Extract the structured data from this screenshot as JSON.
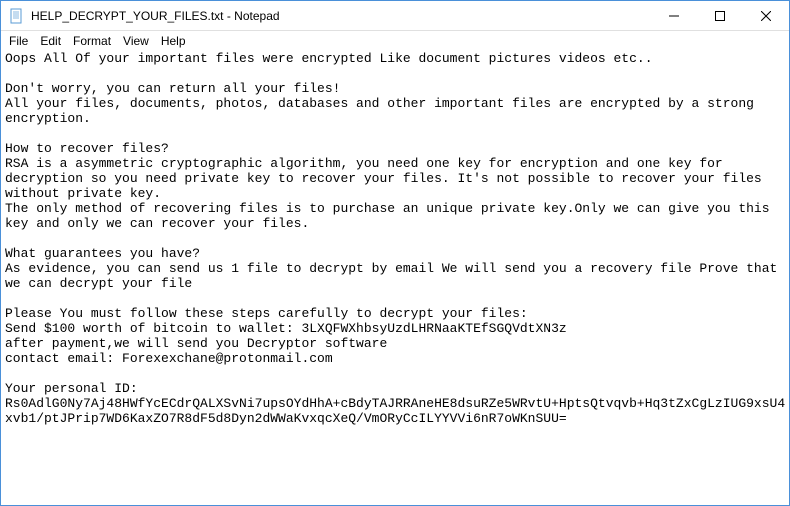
{
  "titlebar": {
    "title": "HELP_DECRYPT_YOUR_FILES.txt - Notepad"
  },
  "menubar": {
    "items": [
      {
        "label": "File"
      },
      {
        "label": "Edit"
      },
      {
        "label": "Format"
      },
      {
        "label": "View"
      },
      {
        "label": "Help"
      }
    ]
  },
  "content": {
    "text": "Oops All Of your important files were encrypted Like document pictures videos etc..\n\nDon't worry, you can return all your files!\nAll your files, documents, photos, databases and other important files are encrypted by a strong encryption.\n\nHow to recover files?\nRSA is a asymmetric cryptographic algorithm, you need one key for encryption and one key for decryption so you need private key to recover your files. It's not possible to recover your files without private key.\nThe only method of recovering files is to purchase an unique private key.Only we can give you this key and only we can recover your files.\n\nWhat guarantees you have?\nAs evidence, you can send us 1 file to decrypt by email We will send you a recovery file Prove that we can decrypt your file\n\nPlease You must follow these steps carefully to decrypt your files:\nSend $100 worth of bitcoin to wallet: 3LXQFWXhbsyUzdLHRNaaKTEfSGQVdtXN3z\nafter payment,we will send you Decryptor software\ncontact email: Forexexchane@protonmail.com\n\nYour personal ID: Rs0AdlG0Ny7Aj48HWfYcECdrQALXSvNi7upsOYdHhA+cBdyTAJRRAneHE8dsuRZe5WRvtU+HptsQtvqvb+Hq3tZxCgLzIUG9xsU4xvb1/ptJPrip7WD6KaxZO7R8dF5d8Dyn2dWWaKvxqcXeQ/VmORyCcILYYVVi6nR7oWKnSUU="
  }
}
